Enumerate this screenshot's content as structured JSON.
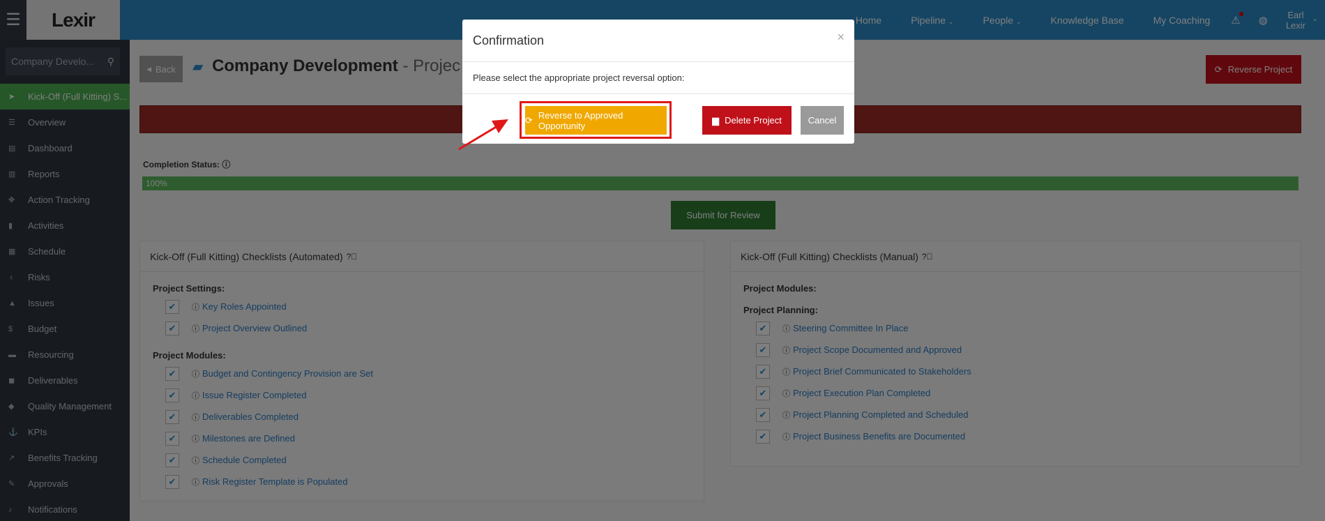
{
  "topbar": {
    "brand": "Lexir",
    "nav": [
      {
        "label": "Home",
        "caret": false
      },
      {
        "label": "Pipeline",
        "caret": true
      },
      {
        "label": "People",
        "caret": true
      },
      {
        "label": "Knowledge Base",
        "caret": false
      },
      {
        "label": "My Coaching",
        "caret": false
      }
    ],
    "user_first": "Earl",
    "user_last": "Lexir"
  },
  "sidebar": {
    "search_value": "Company Develo...",
    "items": [
      {
        "label": "Kick-Off (Full Kitting) S...",
        "icon": "rocket-icon",
        "glyph": "➤",
        "active": true
      },
      {
        "label": "Overview",
        "icon": "list-icon",
        "glyph": "☰",
        "active": false
      },
      {
        "label": "Dashboard",
        "icon": "dashboard-icon",
        "glyph": "▤",
        "active": false
      },
      {
        "label": "Reports",
        "icon": "bar-chart-icon",
        "glyph": "▥",
        "active": false
      },
      {
        "label": "Action Tracking",
        "icon": "crosshair-icon",
        "glyph": "✥",
        "active": false
      },
      {
        "label": "Activities",
        "icon": "bookmark-icon",
        "glyph": "▮",
        "active": false
      },
      {
        "label": "Schedule",
        "icon": "calendar-icon",
        "glyph": "▦",
        "active": false
      },
      {
        "label": "Risks",
        "icon": "lightbulb-icon",
        "glyph": "♁",
        "active": false
      },
      {
        "label": "Issues",
        "icon": "warning-icon",
        "glyph": "▲",
        "active": false
      },
      {
        "label": "Budget",
        "icon": "dollar-icon",
        "glyph": "$",
        "active": false
      },
      {
        "label": "Resourcing",
        "icon": "folder-icon",
        "glyph": "▬",
        "active": false
      },
      {
        "label": "Deliverables",
        "icon": "truck-icon",
        "glyph": "◼",
        "active": false
      },
      {
        "label": "Quality Management",
        "icon": "tag-icon",
        "glyph": "◆",
        "active": false
      },
      {
        "label": "KPIs",
        "icon": "anchor-icon",
        "glyph": "⚓",
        "active": false
      },
      {
        "label": "Benefits Tracking",
        "icon": "line-chart-icon",
        "glyph": "↗",
        "active": false
      },
      {
        "label": "Approvals",
        "icon": "gavel-icon",
        "glyph": "✎",
        "active": false
      },
      {
        "label": "Notifications",
        "icon": "bell-icon",
        "glyph": "♪",
        "active": false
      }
    ]
  },
  "main": {
    "back_label": "Back",
    "title_bold": "Company Development",
    "title_rest": " - Projec",
    "reverse_label": "Reverse Project",
    "completion_label": "Completion Status:",
    "progress_value": 1.0,
    "progress_text": "100%",
    "submit_label": "Submit for Review",
    "automated": {
      "title": "Kick-Off (Full Kitting) Checklists (Automated)",
      "sections": [
        {
          "label": "Project Settings:",
          "items": [
            "Key Roles Appointed",
            "Project Overview Outlined"
          ]
        },
        {
          "label": "Project Modules:",
          "items": [
            "Budget and Contingency Provision are Set",
            "Issue Register Completed",
            "Deliverables Completed",
            "Milestones are Defined",
            "Schedule Completed",
            "Risk Register Template is Populated"
          ]
        }
      ]
    },
    "manual": {
      "title": "Kick-Off (Full Kitting) Checklists (Manual)",
      "sections": [
        {
          "label": "Project Modules:",
          "items": []
        },
        {
          "label": "Project Planning:",
          "items": [
            "Steering Committee In Place",
            "Project Scope Documented and Approved",
            "Project Brief Communicated to Stakeholders",
            "Project Execution Plan Completed",
            "Project Planning Completed and Scheduled",
            "Project Business Benefits are Documented"
          ]
        }
      ]
    }
  },
  "modal": {
    "title": "Confirmation",
    "close": "×",
    "message": "Please select the appropriate project reversal option:",
    "approve_label": "Reverse to Approved Opportunity",
    "delete_label": "Delete Project",
    "cancel_label": "Cancel"
  },
  "colors": {
    "topbar": "#2a8ac7",
    "active": "#4caf50",
    "danger": "#c0101a",
    "warning": "#f0a800",
    "highlight": "#e01818"
  }
}
